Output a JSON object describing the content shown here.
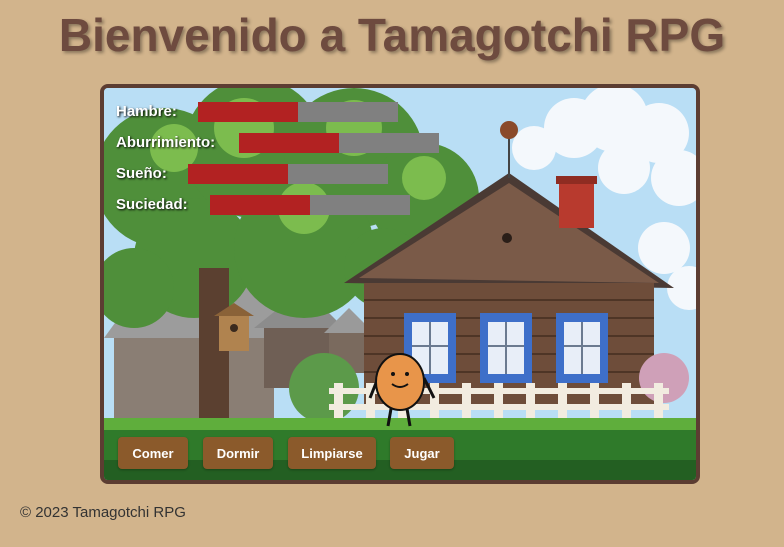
{
  "title": "Bienvenido a Tamagotchi RPG",
  "stats": [
    {
      "label": "Hambre:",
      "value": 0.5
    },
    {
      "label": "Aburrimiento:",
      "value": 0.5
    },
    {
      "label": "Sueño:",
      "value": 0.5
    },
    {
      "label": "Suciedad:",
      "value": 0.5
    }
  ],
  "actions": {
    "comer": "Comer",
    "dormir": "Dormir",
    "limpiarse": "Limpiarse",
    "jugar": "Jugar"
  },
  "footer": "© 2023 Tamagotchi RPG",
  "colors": {
    "background": "#d2b48c",
    "title": "#6e4b3f",
    "bar_fill": "#b22222",
    "bar_track": "#808080",
    "button": "#8b5a2b"
  }
}
